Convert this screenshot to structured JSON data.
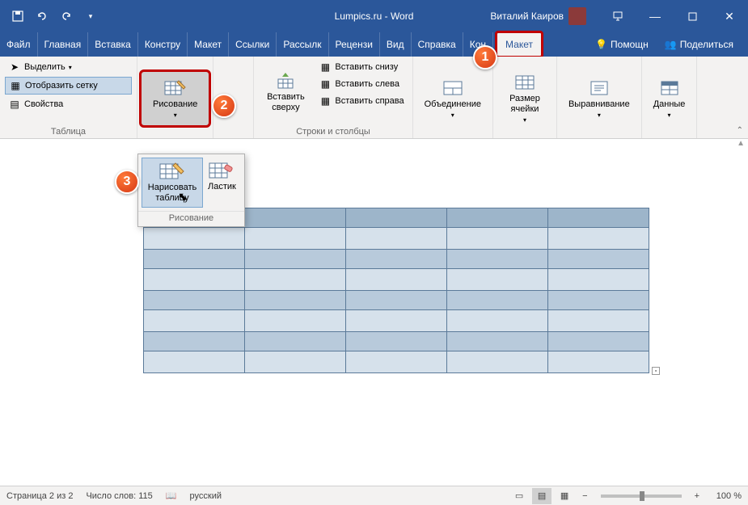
{
  "title": "Lumpics.ru - Word",
  "user": "Виталий Каиров",
  "tabs": {
    "file": "Файл",
    "home": "Главная",
    "insert": "Вставка",
    "design": "Констру",
    "layout": "Макет",
    "references": "Ссылки",
    "mailings": "Рассылк",
    "review": "Рецензи",
    "view": "Вид",
    "help": "Справка",
    "tabledesign": "Кон",
    "tablelayout": "Макет"
  },
  "tellme": "Помощн",
  "share": "Поделиться",
  "ribbon": {
    "table_group": {
      "select": "Выделить",
      "gridlines": "Отобразить сетку",
      "properties": "Свойства",
      "label": "Таблица"
    },
    "draw_group": {
      "draw": "Рисование",
      "label": "Рисование"
    },
    "rowscols_group": {
      "insert_above": "Вставить сверху",
      "insert_below": "Вставить снизу",
      "insert_left": "Вставить слева",
      "insert_right": "Вставить справа",
      "label": "Строки и столбцы"
    },
    "merge": "Объединение",
    "cellsize": "Размер ячейки",
    "align": "Выравнивание",
    "data": "Данные"
  },
  "popup": {
    "draw_table": "Нарисовать таблицу",
    "eraser": "Ластик",
    "label": "Рисование"
  },
  "callouts": {
    "c1": "1",
    "c2": "2",
    "c3": "3"
  },
  "statusbar": {
    "page": "Страница 2 из 2",
    "words": "Число слов: 115",
    "lang": "русский",
    "zoom": "100 %"
  }
}
